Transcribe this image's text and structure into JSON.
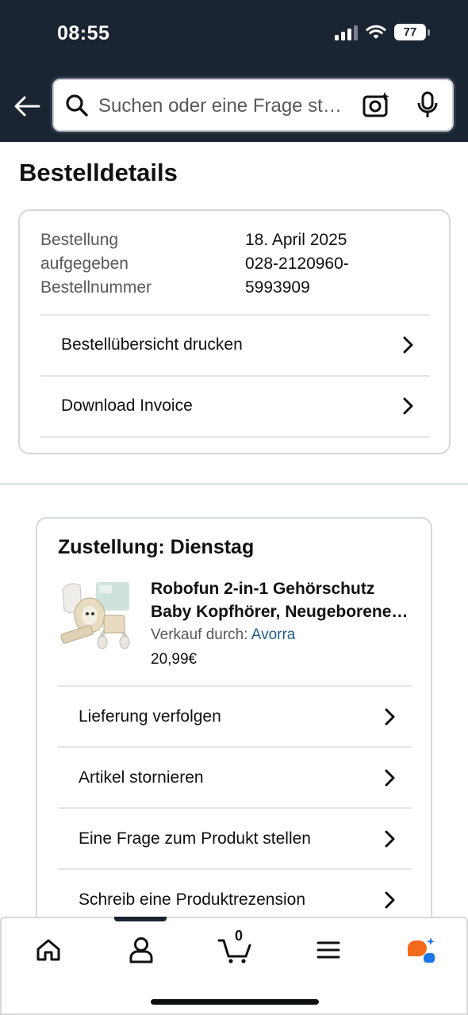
{
  "status_bar": {
    "time": "08:55",
    "battery": "77"
  },
  "header": {
    "search_placeholder": "Suchen oder eine Frage stellen"
  },
  "page": {
    "title": "Bestelldetails"
  },
  "order": {
    "labels": [
      "Bestellung",
      "aufgegeben",
      "Bestellnummer"
    ],
    "values": [
      "18. April 2025",
      "028-2120960-",
      "5993909"
    ],
    "links": [
      "Bestellübersicht drucken",
      "Download Invoice"
    ]
  },
  "delivery": {
    "title": "Zustellung: Dienstag",
    "product": {
      "name_line1": "Robofun 2-in-1 Gehörschutz",
      "name_line2": "Baby Kopfhörer, Neugeborene Lärmschutz",
      "seller_prefix": "Verkauf durch: ",
      "seller_name": "Avorra",
      "price": "20,99€"
    },
    "actions": [
      "Lieferung verfolgen",
      "Artikel stornieren",
      "Eine Frage zum Produkt stellen",
      "Schreib eine Produktrezension"
    ]
  },
  "bottom_nav": {
    "items": [
      "home-icon",
      "account-icon",
      "cart-icon",
      "menu-icon",
      "rufus-icon"
    ],
    "cart_count": "0"
  },
  "colors": {
    "header_bg": "#1b2431",
    "link": "#1f5c8f",
    "rufus_orange": "#f36a1d",
    "rufus_blue": "#1a73e8"
  }
}
